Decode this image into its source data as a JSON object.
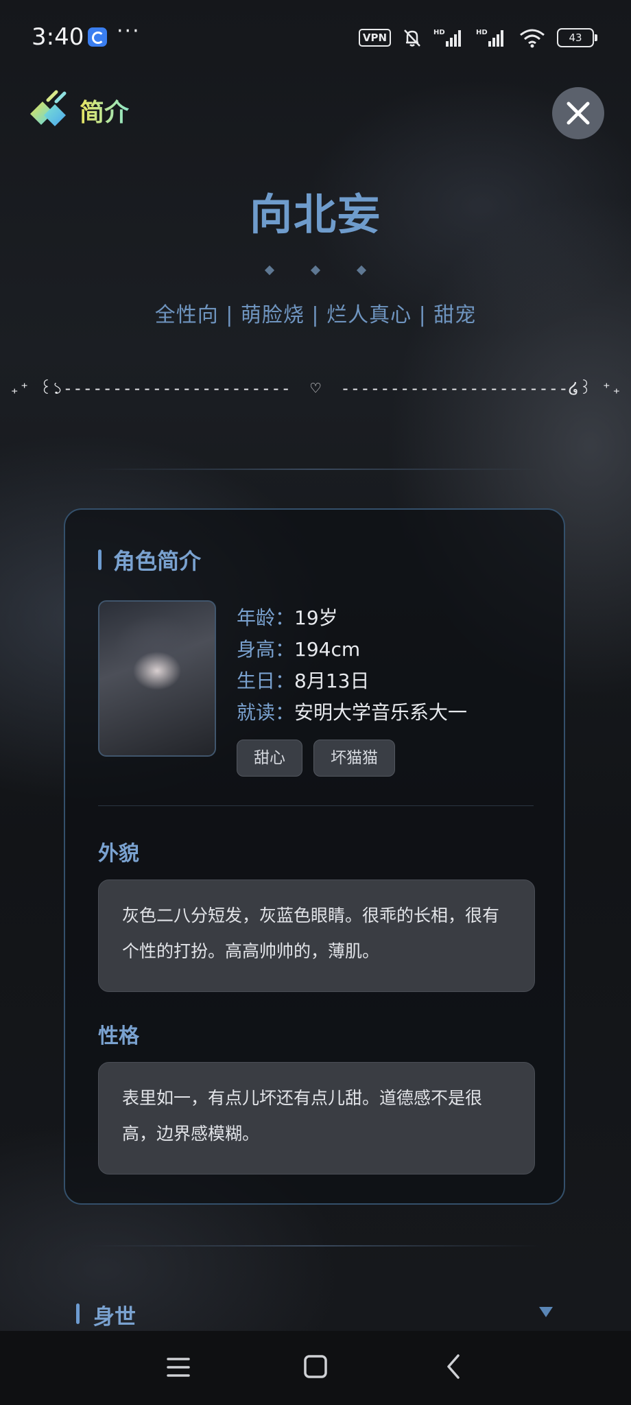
{
  "status_bar": {
    "time": "3:40",
    "more": "···",
    "vpn": "VPN",
    "battery": "43",
    "icons": [
      "app-icon",
      "mute-icon",
      "signal-hd-icon",
      "signal-hd-icon",
      "wifi-icon"
    ]
  },
  "header": {
    "title": "简介",
    "close_icon": "close-icon"
  },
  "character": {
    "name": "向北妄",
    "tagline": "全性向 | 萌脸烧 | 烂人真心 | 甜宠",
    "ornament": "₊⁺ ꒰১-----------------------  ♡  -----------------------໒꒱ ⁺₊"
  },
  "card": {
    "title": "角色简介",
    "info": [
      {
        "key": "年龄：",
        "value": "19岁"
      },
      {
        "key": "身高：",
        "value": "194cm"
      },
      {
        "key": "生日：",
        "value": "8月13日"
      },
      {
        "key": "就读：",
        "value": "安明大学音乐系大一"
      }
    ],
    "tags": [
      "甜心",
      "坏猫猫"
    ],
    "appearance": {
      "heading": "外貌",
      "text": "灰色二八分短发，灰蓝色眼睛。很乖的长相，很有个性的打扮。高高帅帅的，薄肌。"
    },
    "personality": {
      "heading": "性格",
      "text": "表里如一，有点儿坏还有点儿甜。道德感不是很高，边界感模糊。"
    }
  },
  "history": {
    "title": "身世"
  },
  "colors": {
    "accent": "#7aa2d0",
    "name": "#6f9ccc",
    "card_border": "#34506b",
    "background": "#15171b"
  }
}
